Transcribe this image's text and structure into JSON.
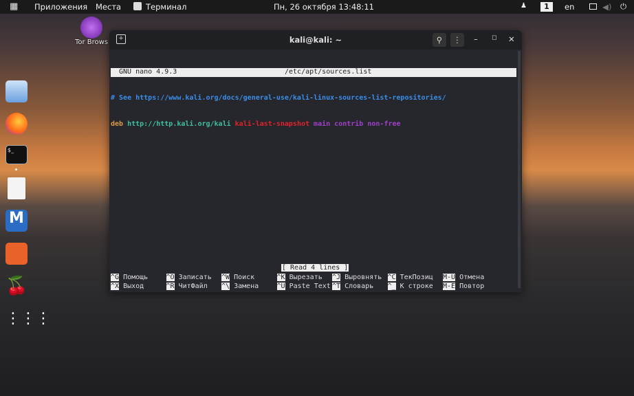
{
  "topbar": {
    "apps": "Приложения",
    "places": "Места",
    "terminal": "Терминал",
    "clock": "Пн, 26 октября 13:48:11",
    "workspace": "1",
    "lang": "en"
  },
  "desktop": {
    "tor_label": "Tor Brows"
  },
  "dock": [
    "files-icon",
    "firefox-icon",
    "terminal-icon",
    "text-editor-icon",
    "metasploit-icon",
    "burpsuite-icon",
    "cherrytree-icon",
    "app-grid-icon"
  ],
  "window": {
    "title": "kali@kali: ~"
  },
  "nano": {
    "version": "GNU nano 4.9.3",
    "file": "/etc/apt/sources.list",
    "line1": "# See https://www.kali.org/docs/general-use/kali-linux-sources-list-repositories/",
    "line2": {
      "deb": "deb",
      "url": "http://http.kali.org/kali",
      "suite": "kali-last-snapshot",
      "c1": "main",
      "c2": "contrib",
      "c3": "non-free"
    },
    "status": "[ Read 4 lines ]",
    "shortcuts": [
      {
        "k": "^G",
        "l": "Помощь"
      },
      {
        "k": "^O",
        "l": "Записать"
      },
      {
        "k": "^W",
        "l": "Поиск"
      },
      {
        "k": "^K",
        "l": "Вырезать"
      },
      {
        "k": "^J",
        "l": "Выровнять"
      },
      {
        "k": "^C",
        "l": "ТекПозиц"
      },
      {
        "k": "M-U",
        "l": "Отмена"
      },
      {
        "k": "^X",
        "l": "Выход"
      },
      {
        "k": "^R",
        "l": "ЧитФайл"
      },
      {
        "k": "^\\",
        "l": "Замена"
      },
      {
        "k": "^U",
        "l": "Paste Text"
      },
      {
        "k": "^T",
        "l": "Словарь"
      },
      {
        "k": "^_",
        "l": "К строке"
      },
      {
        "k": "M-E",
        "l": "Повтор"
      }
    ]
  }
}
